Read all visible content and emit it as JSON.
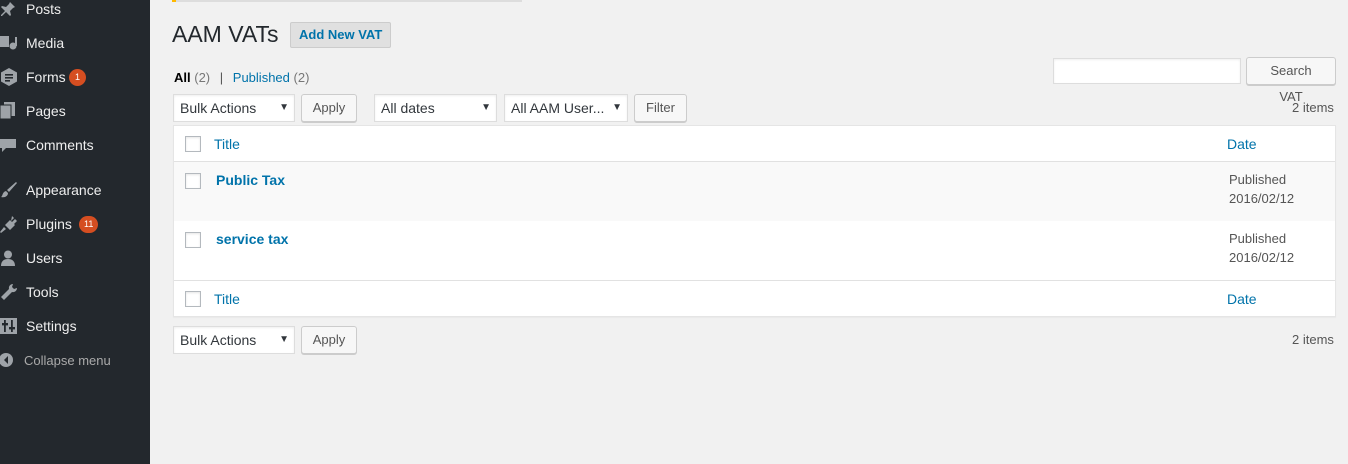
{
  "sidebar": {
    "items": [
      {
        "label": "Posts",
        "icon": "pushpin-icon"
      },
      {
        "label": "Media",
        "icon": "media-icon"
      },
      {
        "label": "Forms",
        "icon": "forms-icon",
        "badge": "1"
      },
      {
        "label": "Pages",
        "icon": "pages-icon"
      },
      {
        "label": "Comments",
        "icon": "comments-icon"
      },
      {
        "label": "Appearance",
        "icon": "paintbrush-icon"
      },
      {
        "label": "Plugins",
        "icon": "plugin-icon",
        "badge": "11"
      },
      {
        "label": "Users",
        "icon": "user-icon"
      },
      {
        "label": "Tools",
        "icon": "wrench-icon"
      },
      {
        "label": "Settings",
        "icon": "settings-icon"
      }
    ],
    "collapse_label": "Collapse menu"
  },
  "header": {
    "title": "AAM VATs",
    "add_new_label": "Add New VAT"
  },
  "filters": {
    "all_label": "All",
    "all_count": "(2)",
    "separator": "|",
    "published_label": "Published",
    "published_count": "(2)"
  },
  "search": {
    "value": "",
    "button_label": "Search VAT"
  },
  "toolbar_top": {
    "bulk_actions": "Bulk Actions",
    "apply_label": "Apply",
    "dates_filter": "All dates",
    "users_filter": "All AAM User...",
    "filter_label": "Filter",
    "items_count": "2 items"
  },
  "table": {
    "columns": {
      "title": "Title",
      "date": "Date"
    },
    "rows": [
      {
        "title": "Public Tax",
        "status": "Published",
        "date": "2016/02/12"
      },
      {
        "title": "service tax",
        "status": "Published",
        "date": "2016/02/12"
      }
    ]
  },
  "toolbar_bottom": {
    "bulk_actions": "Bulk Actions",
    "apply_label": "Apply",
    "items_count": "2 items"
  },
  "colors": {
    "sidebar_bg": "#23282d",
    "link": "#0073aa",
    "badge": "#d54e21",
    "page_bg": "#f1f1f1"
  }
}
